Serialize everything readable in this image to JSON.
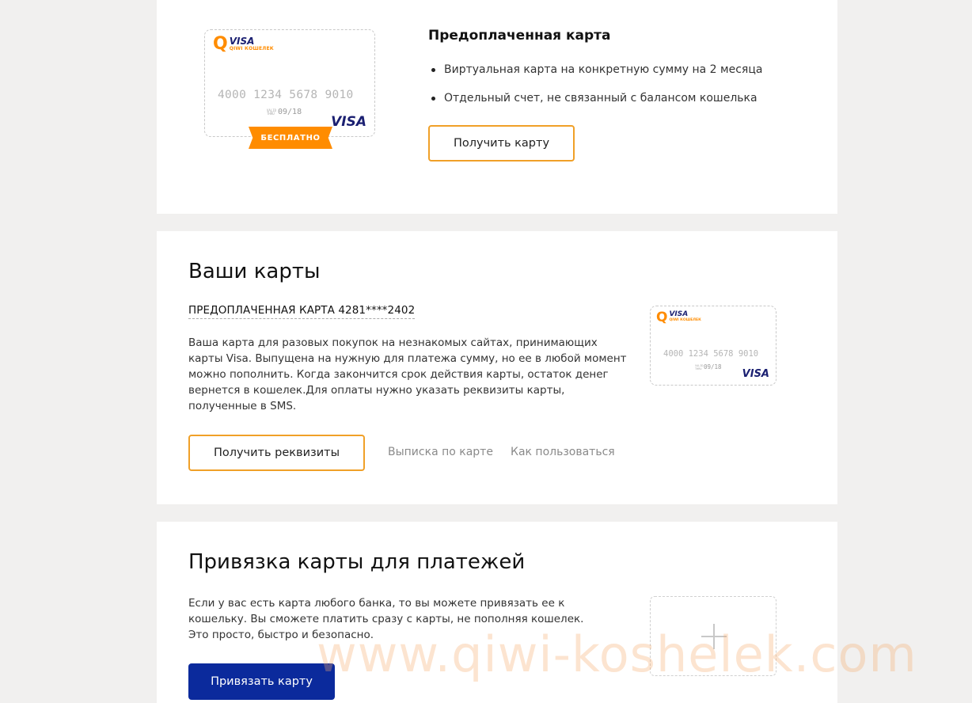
{
  "prepaid": {
    "card": {
      "brand_title": "VISA",
      "brand_sub": "QIWI КОШЕЛЕК",
      "number": "4000 1234 5678 9010",
      "valid_label": "VALID THRU",
      "expiry": "09/18",
      "network": "VISA",
      "ribbon": "БЕСПЛАТНО"
    },
    "title": "Предоплаченная карта",
    "bullets": [
      "Виртуальная карта на конкретную сумму на 2 месяца",
      "Отдельный счет, не связанный с балансом кошелька"
    ],
    "button": "Получить карту"
  },
  "your_cards": {
    "title": "Ваши карты",
    "card_name": "ПРЕДОПЛАЧЕННАЯ КАРТА 4281****2402",
    "description": "Ваша карта для разовых покупок на незнакомых сайтах, принимающих карты Visa. Выпущена на нужную для платежа сумму, но ее в любой момент можно пополнить. Когда закончится срок действия карты, остаток денег вернется в кошелек.Для оплаты нужно указать реквизиты карты, полученные в SMS.",
    "button": "Получить реквизиты",
    "link_statement": "Выписка по карте",
    "link_howto": "Как пользоваться",
    "card": {
      "brand_title": "VISA",
      "brand_sub": "QIWI КОШЕЛЕК",
      "number": "4000 1234 5678 9010",
      "valid_label": "VALID THRU",
      "expiry": "09/18",
      "network": "VISA"
    }
  },
  "link_card": {
    "title": "Привязка карты для платежей",
    "description": "Если у вас есть карта любого банка, то вы можете привязать ее к кошельку. Вы сможете платить сразу с карты, не пополняя кошелек. Это просто, быстро и безопасно.",
    "button": "Привязать карту"
  },
  "watermark": "www.qiwi-koshelek.com",
  "colors": {
    "accent_orange": "#f0a028",
    "ribbon_orange": "#ff8c00",
    "primary_blue": "#0b2a9c",
    "visa_blue": "#1a1f71",
    "background": "#f1f0ef"
  },
  "icons": [
    "qiwi-logo-icon",
    "visa-logo-icon",
    "plus-icon"
  ]
}
